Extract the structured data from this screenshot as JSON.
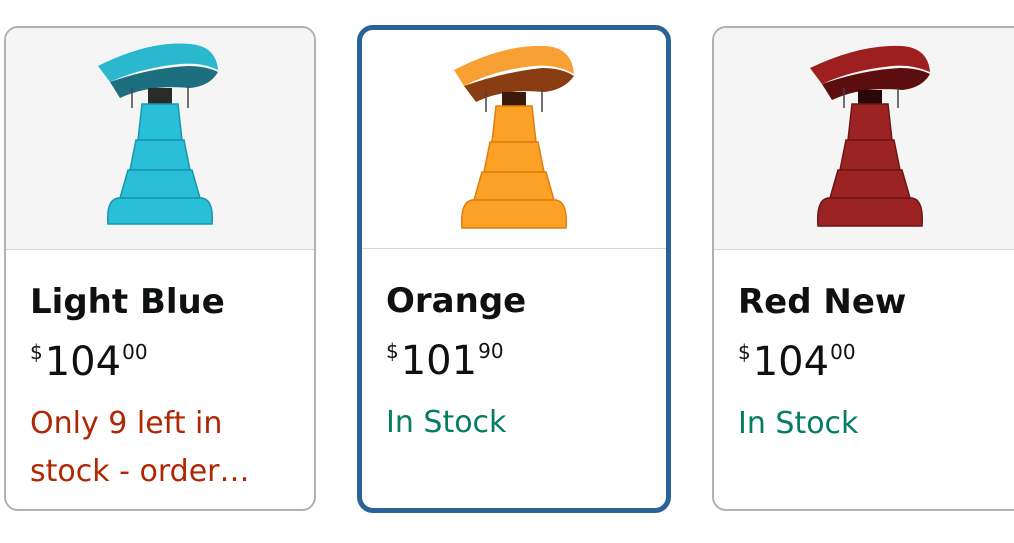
{
  "swatches": [
    {
      "name": "Light Blue",
      "price_symbol": "$",
      "price_whole": "104",
      "price_fraction": "00",
      "availability": "Only 9 left in stock - order…",
      "availability_status": "low",
      "selected": false,
      "colors": {
        "canopy": "#2bb8cf",
        "canopy_dark": "#1d6f80",
        "cushion": "#29bfd9",
        "cushion_dark": "#1996ad"
      }
    },
    {
      "name": "Orange",
      "price_symbol": "$",
      "price_whole": "101",
      "price_fraction": "90",
      "availability": "In Stock",
      "availability_status": "in",
      "selected": true,
      "colors": {
        "canopy": "#f7a135",
        "canopy_dark": "#8a3d12",
        "cushion": "#fba125",
        "cushion_dark": "#e07c10"
      }
    },
    {
      "name": "Red New",
      "price_symbol": "$",
      "price_whole": "104",
      "price_fraction": "00",
      "availability": "In Stock",
      "availability_status": "in",
      "selected": false,
      "colors": {
        "canopy": "#9e1f1f",
        "canopy_dark": "#5c0e0e",
        "cushion": "#9b2323",
        "cushion_dark": "#6e1515"
      }
    }
  ],
  "theme": {
    "selected_border": "#2a6496",
    "in_stock": "#067d62",
    "low_stock": "#b12704"
  }
}
